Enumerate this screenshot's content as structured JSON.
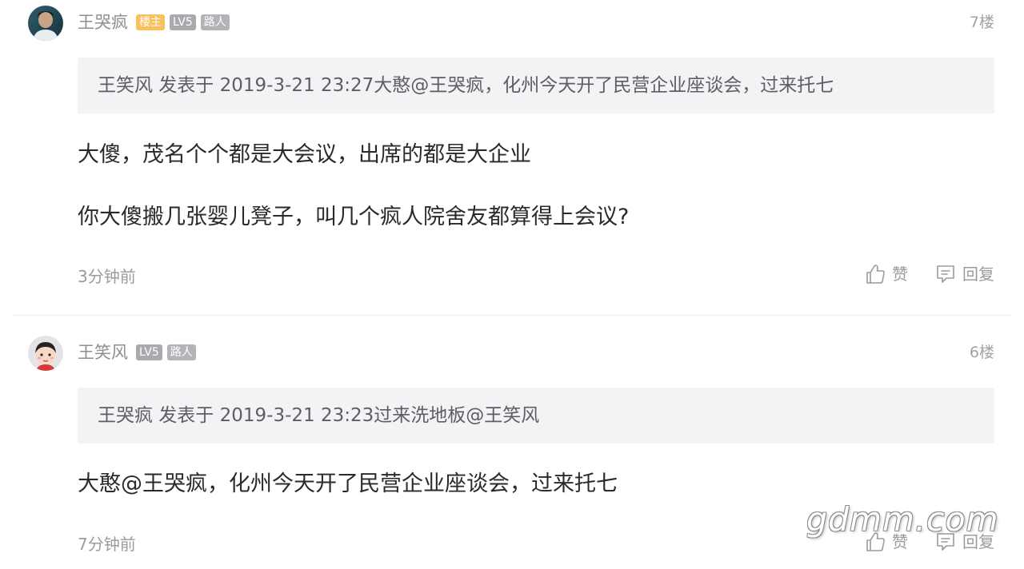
{
  "posts": [
    {
      "author": "王哭疯",
      "badges": {
        "owner": "楼主",
        "level": "LV5",
        "role": "路人"
      },
      "floor": "7楼",
      "quote": "王笑风 发表于 2019-3-21 23:27大憨@王哭疯，化州今天开了民营企业座谈会，过来托七",
      "content": [
        "大傻，茂名个个都是大会议，出席的都是大企业",
        "你大傻搬几张婴儿凳子，叫几个疯人院舍友都算得上会议?"
      ],
      "time": "3分钟前",
      "like_label": "赞",
      "reply_label": "回复"
    },
    {
      "author": "王笑风",
      "badges": {
        "level": "LV5",
        "role": "路人"
      },
      "floor": "6楼",
      "quote": "王哭疯 发表于 2019-3-21 23:23过来洗地板@王笑风",
      "content": [
        "大憨@王哭疯，化州今天开了民营企业座谈会，过来托七"
      ],
      "time": "7分钟前",
      "like_label": "赞",
      "reply_label": "回复"
    }
  ],
  "watermark": "gdmm.com",
  "colors": {
    "owner_badge": "#f7c15e",
    "level_badge": "#a9a9ae",
    "quote_bg": "#f3f3f5",
    "meta_text": "#9a9aa0"
  },
  "icons": {
    "like": "thumbs-up-icon",
    "reply": "comment-bubble-icon"
  }
}
